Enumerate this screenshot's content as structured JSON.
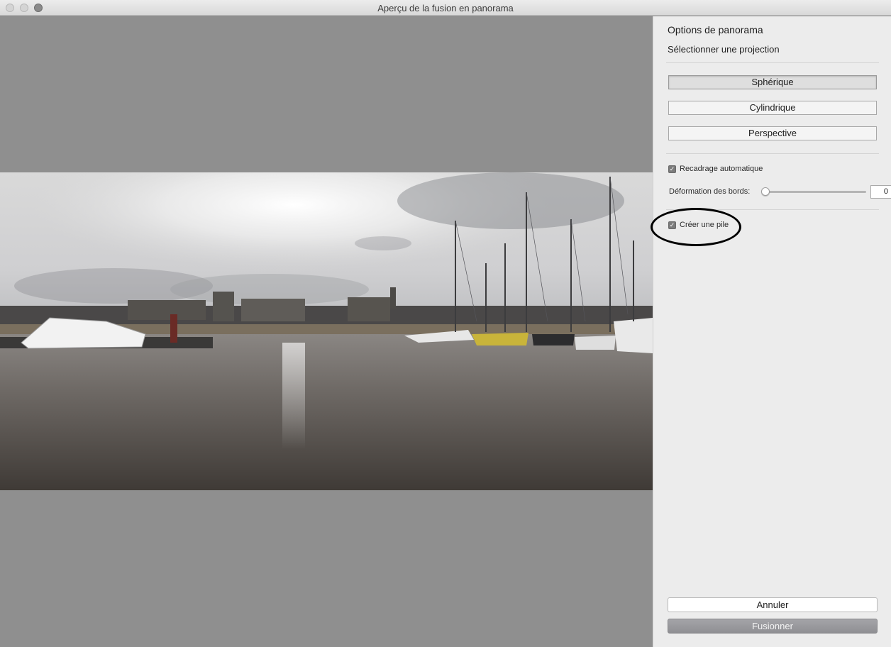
{
  "window": {
    "title": "Aperçu de la fusion en panorama"
  },
  "panel": {
    "heading": "Options de panorama",
    "subheading": "Sélectionner une projection",
    "projections": [
      {
        "label": "Sphérique",
        "selected": true
      },
      {
        "label": "Cylindrique",
        "selected": false
      },
      {
        "label": "Perspective",
        "selected": false
      }
    ],
    "auto_crop": {
      "label": "Recadrage automatique",
      "checked": true
    },
    "boundary_warp": {
      "label": "Déformation des bords:",
      "value": "0",
      "level": 0
    },
    "create_stack": {
      "label": "Créer une pile",
      "checked": true
    },
    "cancel_label": "Annuler",
    "merge_label": "Fusionner"
  },
  "colors": {
    "preview_bg": "#8f8f8f",
    "panel_bg": "#ececec",
    "merge_button": "#9a9a9e",
    "highlight_ring": "#000000"
  }
}
